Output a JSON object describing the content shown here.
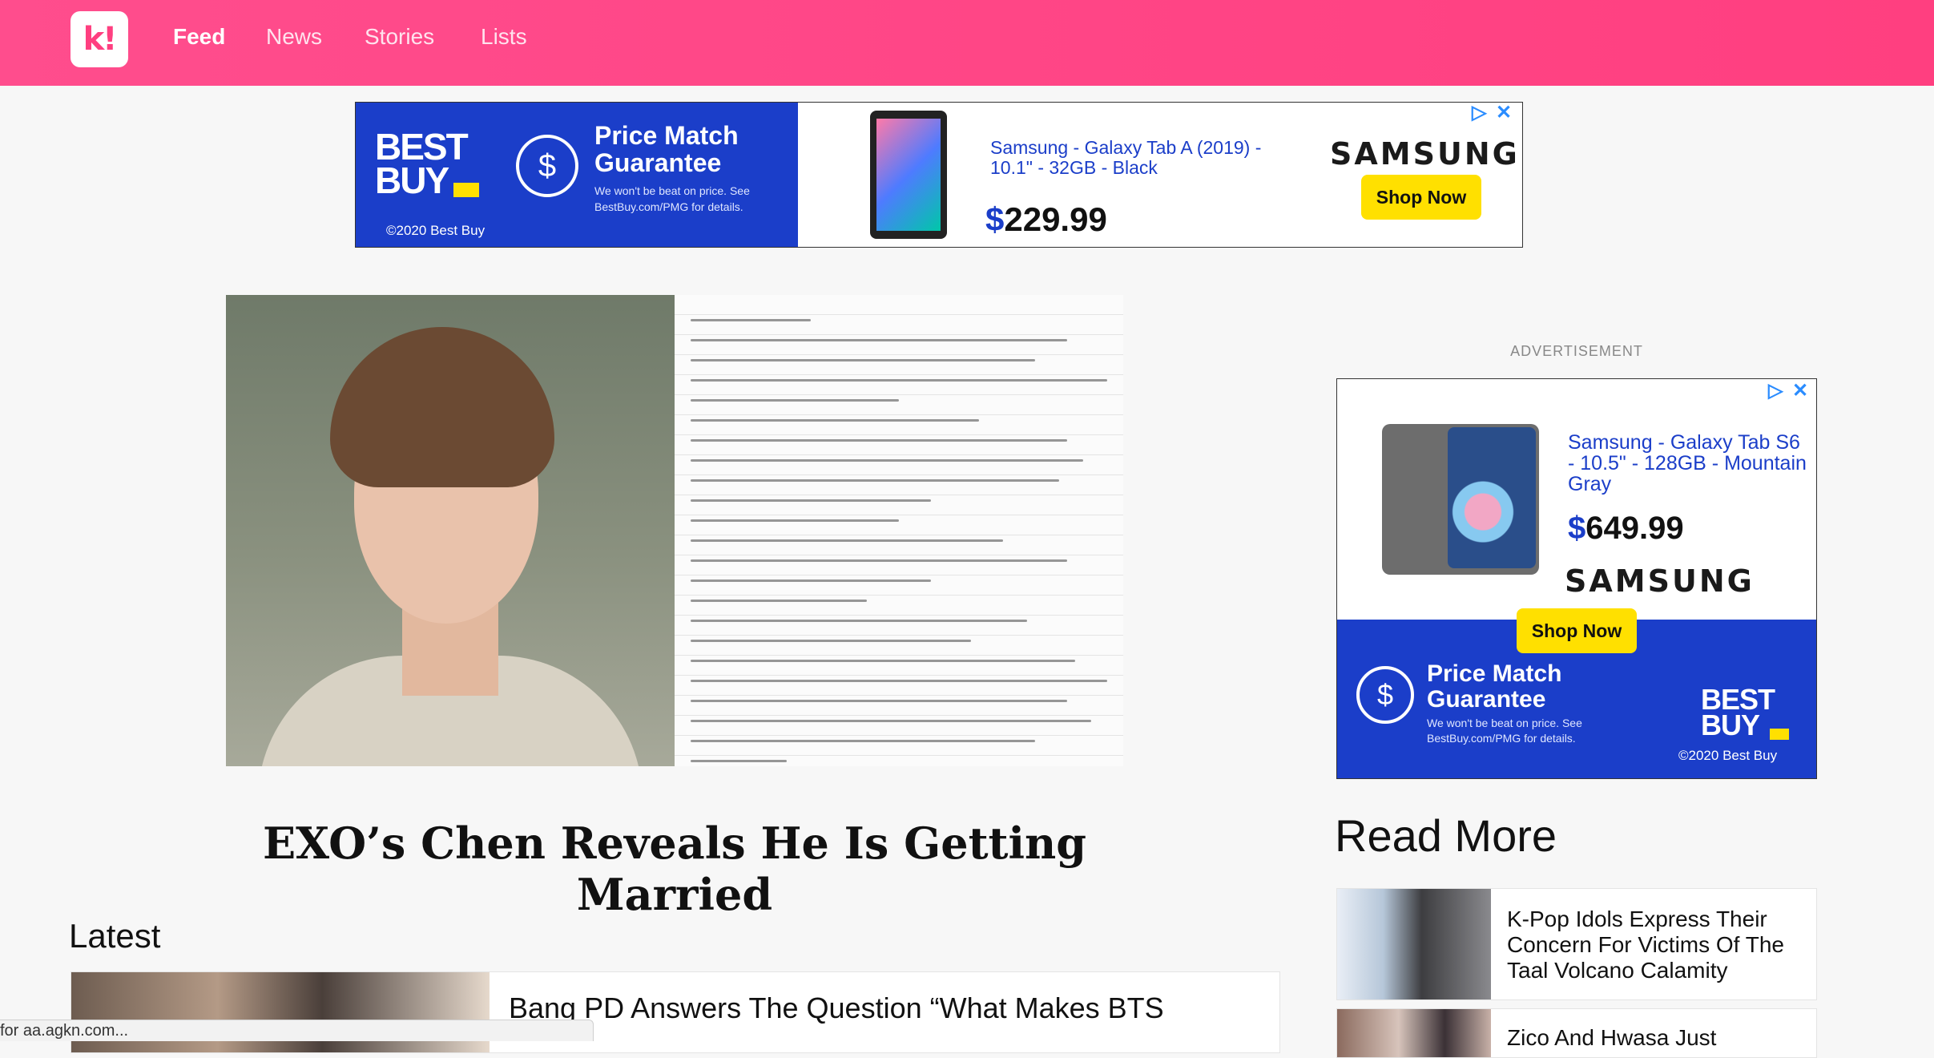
{
  "nav": {
    "logo": "k!",
    "links": [
      "Feed",
      "News",
      "Stories",
      "Lists"
    ]
  },
  "top_ad": {
    "brand": "BEST BUY",
    "copyright": "©2020 Best Buy",
    "pm_title": "Price Match Guarantee",
    "pm_sub": "We won't be beat on price. See BestBuy.com/PMG for details.",
    "product": "Samsung - Galaxy Tab A (2019) - 10.1\" - 32GB - Black",
    "price_currency": "$",
    "price_amount": "229.99",
    "samsung": "SAMSUNG",
    "shop": "Shop Now"
  },
  "hero": {
    "title": "EXO’s Chen Reveals He Is Getting Married"
  },
  "latest": {
    "heading": "Latest",
    "title": "Bang PD Answers The Question “What Makes BTS"
  },
  "status_bar": "for aa.agkn.com...",
  "side_ad": {
    "label": "ADVERTISEMENT",
    "product": "Samsung - Galaxy Tab S6 - 10.5\" - 128GB - Mountain Gray",
    "price_currency": "$",
    "price_amount": "649.99",
    "samsung": "SAMSUNG",
    "shop": "Shop Now",
    "pm_title": "Price Match Guarantee",
    "pm_sub": "We won't be beat on price. See BestBuy.com/PMG for details.",
    "brand": "BEST BUY",
    "copyright": "©2020 Best Buy"
  },
  "read_more": {
    "heading": "Read More",
    "items": [
      {
        "title": "K-Pop Idols Express Their Concern For Victims Of The Taal Volcano Calamity"
      },
      {
        "title": "Zico And Hwasa Just"
      }
    ]
  },
  "colors": {
    "brand_pink": "#ff3f80",
    "bestbuy_blue": "#1b3ec9",
    "bestbuy_yellow": "#ffe000"
  }
}
